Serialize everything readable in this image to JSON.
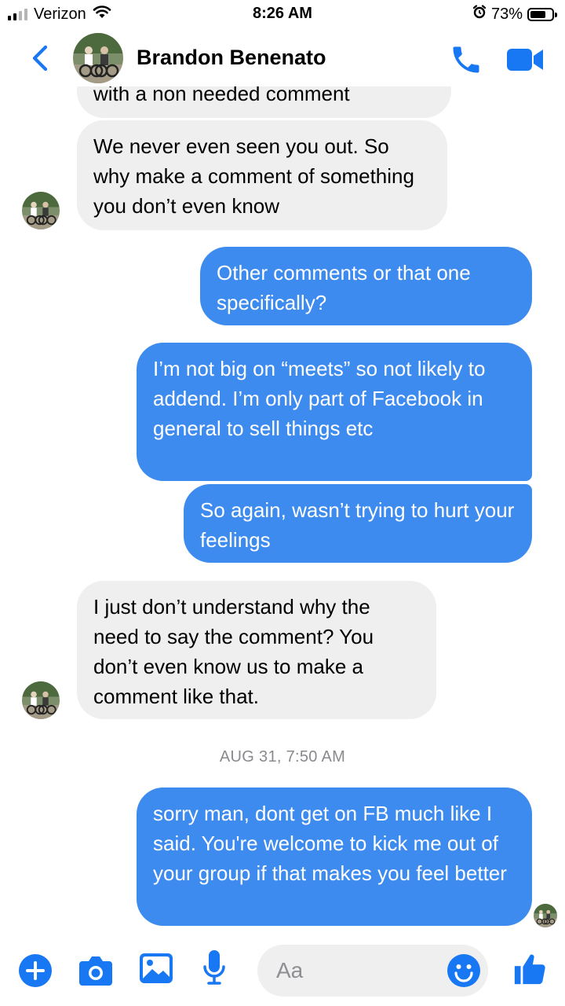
{
  "status_bar": {
    "carrier": "Verizon",
    "time": "8:26 AM",
    "battery": "73%",
    "icons": [
      "signal-icon",
      "wifi-icon",
      "alarm-icon",
      "battery-icon"
    ]
  },
  "header": {
    "contact_name": "Brandon Benenato",
    "icons": [
      "back-chevron-icon",
      "phone-icon",
      "video-camera-icon"
    ]
  },
  "messages": [
    {
      "direction": "incoming",
      "text": "with a non needed comment"
    },
    {
      "direction": "incoming",
      "text": "We never even seen you out. So why make a comment of something you don’t even know"
    },
    {
      "direction": "outgoing",
      "text": "Other comments or that one specifically?"
    },
    {
      "direction": "outgoing",
      "text": "I’m not big on “meets” so not likely to addend. I’m only part of Facebook in general to sell things etc"
    },
    {
      "direction": "outgoing",
      "text": "So again, wasn’t trying to hurt your feelings"
    },
    {
      "direction": "incoming",
      "text": "I just don’t understand why the need to say the comment? You don’t even know us to make a comment like that."
    },
    {
      "direction": "outgoing",
      "text": "sorry man, dont get on FB much like I said. You're welcome to kick me out of your group if that makes you feel better"
    }
  ],
  "timestamp": "AUG 31, 7:50 AM",
  "composer": {
    "placeholder": "Aa",
    "icons": [
      "plus-icon",
      "camera-icon",
      "gallery-icon",
      "microphone-icon",
      "emoji-icon",
      "thumbs-up-icon"
    ]
  },
  "colors": {
    "accent": "#1877f2",
    "outgoing_bubble": "#3d8bef",
    "incoming_bubble": "#efefef",
    "timestamp_text": "#8a8a8e"
  }
}
